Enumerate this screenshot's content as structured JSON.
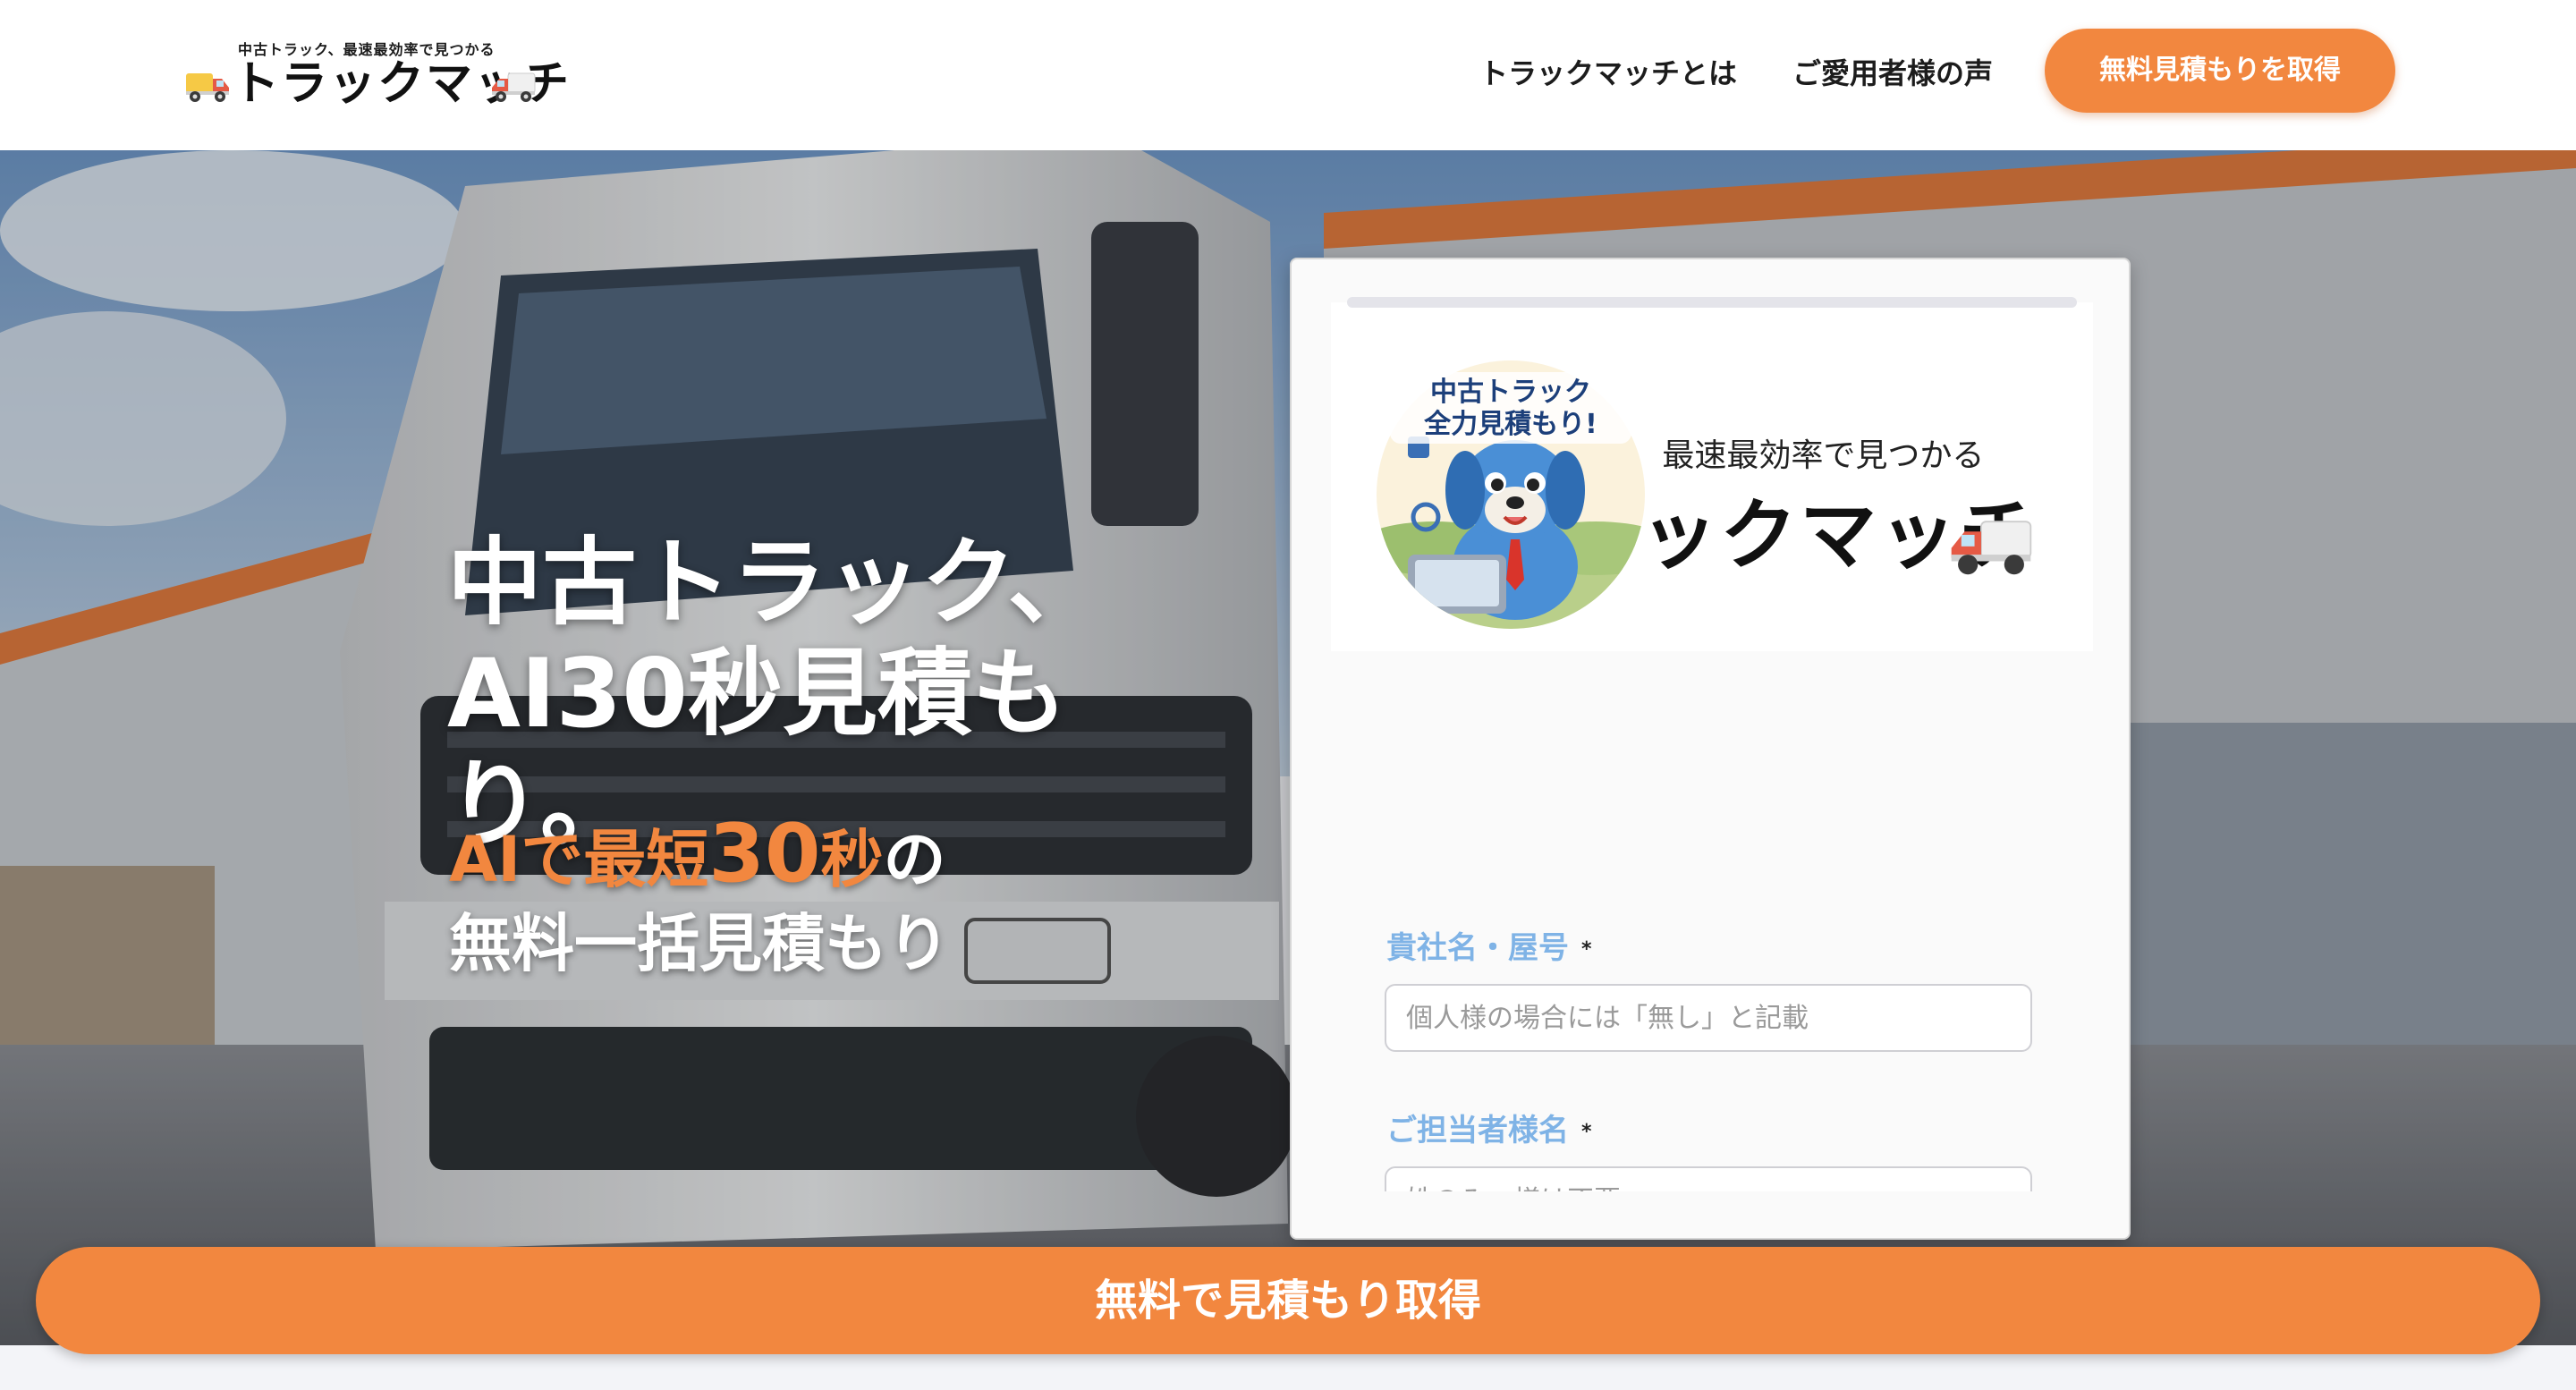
{
  "header": {
    "brand_tagline": "中古トラック、最速最効率で見つかる",
    "brand_name": "トラックマッチ",
    "nav": [
      "トラックマッチとは",
      "ご愛用者様の声"
    ],
    "cta": "無料見積もりを取得"
  },
  "hero": {
    "title_line1": "中古トラック、",
    "title_line2": "AI30秒見積もり。",
    "sub_ai": "AIで最短",
    "sub_num": "30",
    "sub_sec": "秒",
    "sub_no": "の",
    "sub_line2": "無料一括見積もり"
  },
  "form": {
    "logo_tagline": "中古トラック、最速最効率で見つかる",
    "logo_name": "トラックマッチ",
    "mascot_caption_1": "中古トラック",
    "mascot_caption_2": "全力見積もり!",
    "fields": [
      {
        "label": "貴社名・屋号",
        "required": "*",
        "placeholder": "個人様の場合には「無し」と記載"
      },
      {
        "label": "ご担当者様名",
        "required": "*",
        "placeholder": "姓のみ・様は不要"
      }
    ]
  },
  "bottom_cta": "無料で見積もり取得",
  "colors": {
    "accent": "#f2873f",
    "label_blue": "#7fb3e6"
  }
}
